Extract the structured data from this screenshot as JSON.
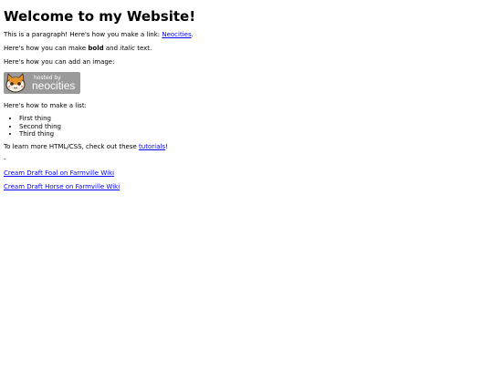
{
  "heading": "Welcome to my Website!",
  "p1": {
    "before": "This is a paragraph! Here's how you make a link: ",
    "link": "Neocities",
    "after": "."
  },
  "p2": {
    "before": "Here's how you can make ",
    "bold": "bold",
    "middle": " and ",
    "italic": "italic",
    "after": " text."
  },
  "p3": "Here's how you can add an image:",
  "badge": {
    "small_text": "hosted by",
    "big_text": "neocities",
    "icon": "neocities-cat-icon",
    "background_color": "#9a9a9a"
  },
  "p4": "Here's how to make a list:",
  "list_items": [
    "First thing",
    "Second thing",
    "Third thing"
  ],
  "p5": {
    "before": "To learn more HTML/CSS, check out these ",
    "link": "tutorials",
    "after": "!"
  },
  "dash": "-",
  "links": [
    "Cream Draft Foal on Farmville Wiki",
    "Cream Draft Horse on Farmville Wiki"
  ],
  "colors": {
    "link": "#0000ee",
    "text": "#000000",
    "background": "#ffffff"
  }
}
